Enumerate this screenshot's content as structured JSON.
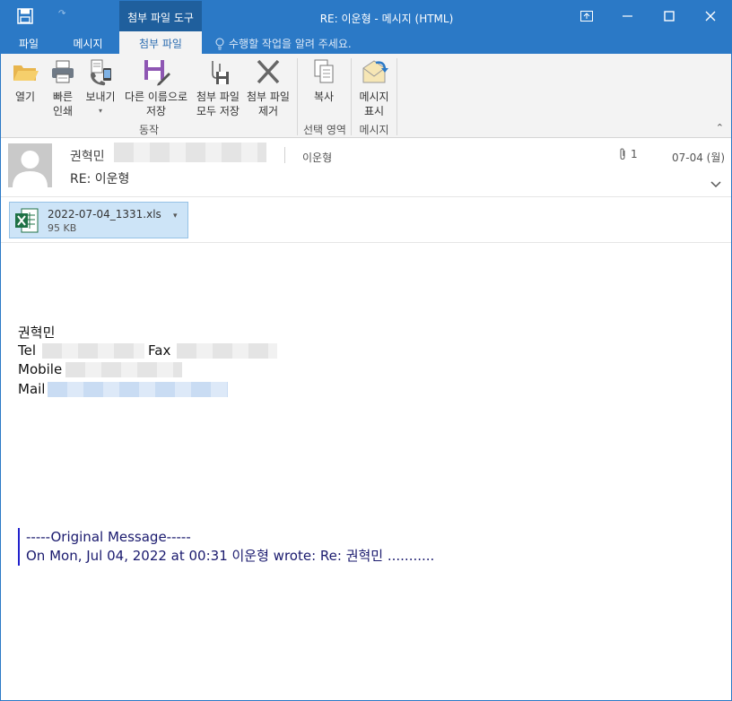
{
  "titlebar": {
    "title": "RE: 이운형 - 메시지 (HTML)",
    "contextual_tab_group": "첨부 파일 도구",
    "controls": [
      "restore-down",
      "minimize",
      "maximize",
      "close"
    ]
  },
  "tabs": [
    {
      "label": "파일",
      "active": false
    },
    {
      "label": "메시지",
      "active": false
    },
    {
      "label": "첨부 파일",
      "active": true
    }
  ],
  "tellme": {
    "placeholder": "수행할 작업을 알려 주세요."
  },
  "ribbon": {
    "open": "열기",
    "quick_print_1": "빠른",
    "quick_print_2": "인쇄",
    "send": "보내기",
    "save_as_1": "다른 이름으로",
    "save_as_2": "저장",
    "save_all_1": "첨부 파일",
    "save_all_2": "모두 저장",
    "remove_1": "첨부 파일",
    "remove_2": "제거",
    "copy": "복사",
    "show_msg_1": "메시지",
    "show_msg_2": "표시",
    "group_actions": "동작",
    "group_selection": "선택 영역",
    "group_message": "메시지"
  },
  "header": {
    "sender": "권혁민",
    "to": "이운형",
    "attachment_count": "1",
    "date": "07-04 (월)",
    "subject": "RE: 이운형"
  },
  "attachment": {
    "name": "2022-07-04_1331.xls",
    "size": "95 KB"
  },
  "body": {
    "sig_name": "권혁민",
    "tel_label": "Tel",
    "fax_label": "Fax",
    "mobile_label": "Mobile",
    "mail_label": "Mail",
    "orig_header": "-----Original Message-----",
    "orig_line": "On Mon, Jul 04, 2022 at 00:31 이운형 wrote: Re: 권혁민 ..........."
  },
  "colors": {
    "accent": "#2b79c6",
    "ribbon_bg": "#f3f3f3",
    "attachment_bg": "#cde4f7",
    "quote_border": "#2222cc"
  }
}
